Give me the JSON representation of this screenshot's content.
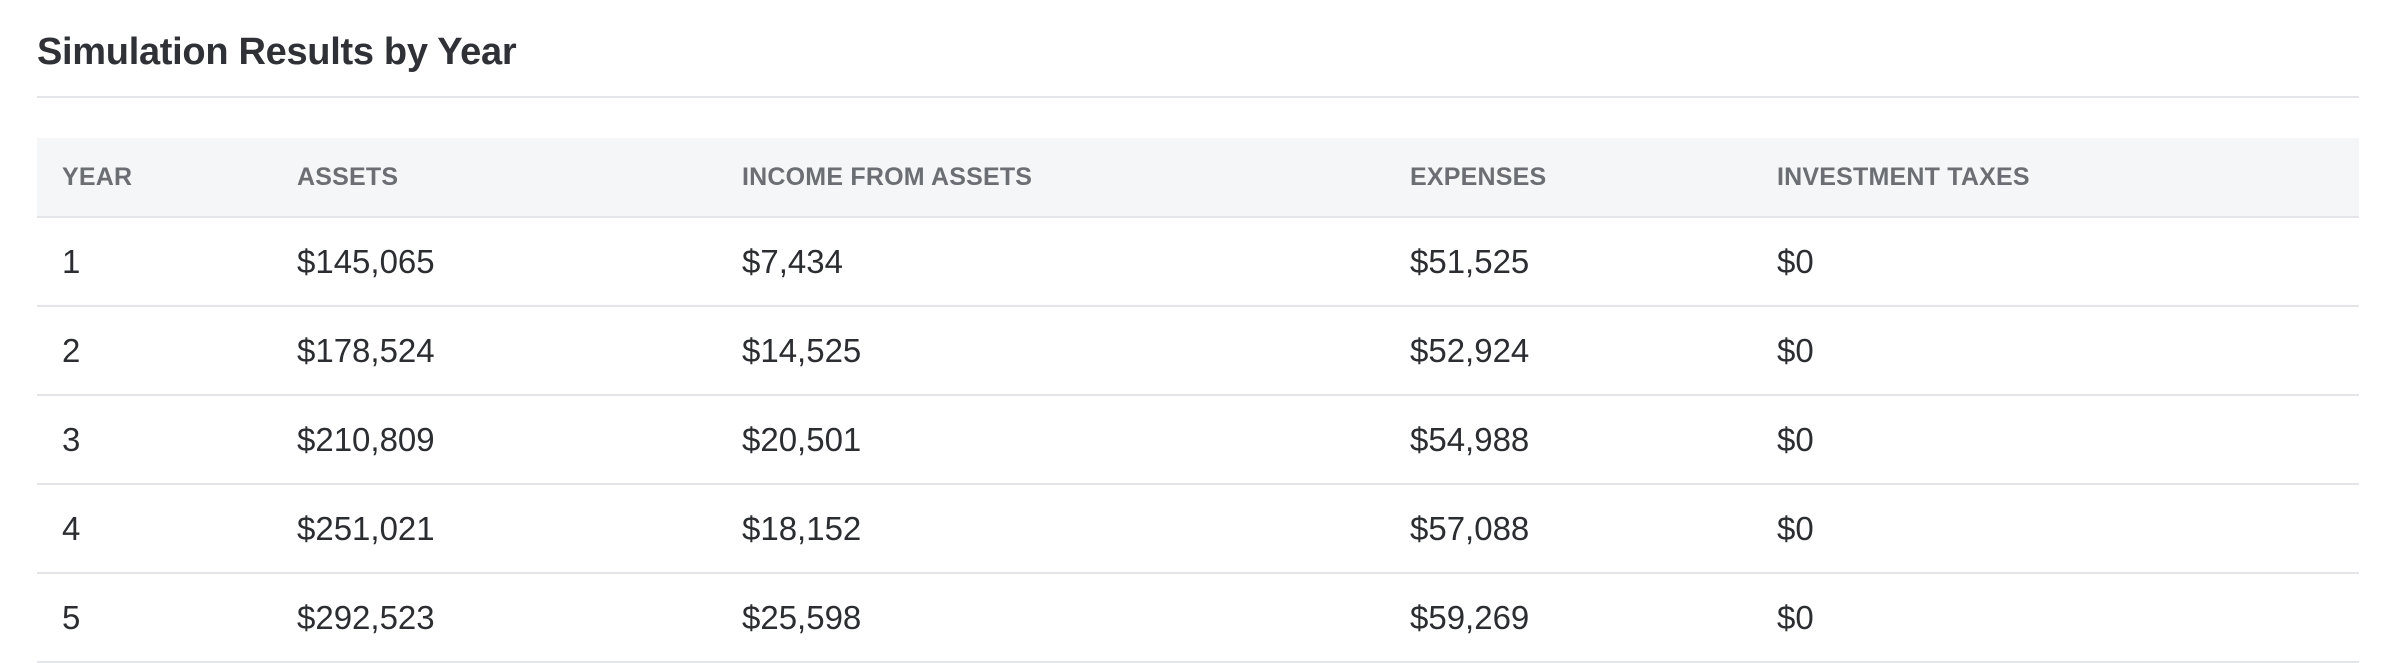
{
  "section": {
    "title": "Simulation Results by Year"
  },
  "table": {
    "columns": [
      "YEAR",
      "ASSETS",
      "INCOME FROM ASSETS",
      "EXPENSES",
      "INVESTMENT TAXES"
    ],
    "rows": [
      [
        "1",
        "$145,065",
        "$7,434",
        "$51,525",
        "$0"
      ],
      [
        "2",
        "$178,524",
        "$14,525",
        "$52,924",
        "$0"
      ],
      [
        "3",
        "$210,809",
        "$20,501",
        "$54,988",
        "$0"
      ],
      [
        "4",
        "$251,021",
        "$18,152",
        "$57,088",
        "$0"
      ],
      [
        "5",
        "$292,523",
        "$25,598",
        "$59,269",
        "$0"
      ]
    ]
  }
}
